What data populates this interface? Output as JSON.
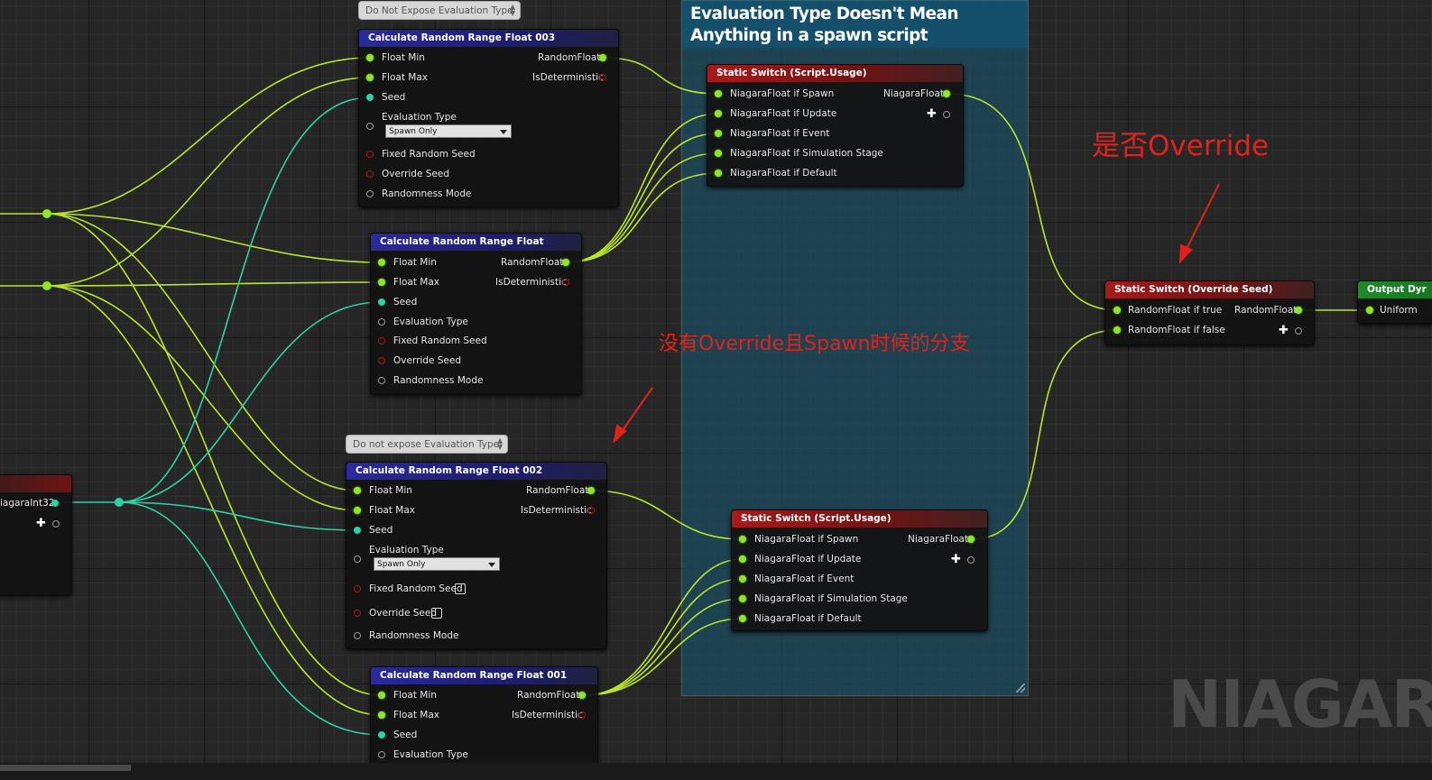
{
  "comment_box": {
    "title": "Evaluation Type Doesn't Mean Anything in a spawn script"
  },
  "bubbles": {
    "top": "Do Not Expose Evaluation Type",
    "mid": "Do not expose Evaluation Type"
  },
  "nodes": {
    "crrf003": {
      "title": "Calculate Random Range Float 003",
      "inputs": [
        "Float Min",
        "Float Max",
        "Seed"
      ],
      "eval_label": "Evaluation Type",
      "eval_value": "Spawn Only",
      "extra": [
        "Fixed Random Seed",
        "Override Seed",
        "Randomness Mode"
      ],
      "outputs": [
        "RandomFloat",
        "IsDeterministic"
      ]
    },
    "crrf": {
      "title": "Calculate Random Range Float",
      "inputs": [
        "Float Min",
        "Float Max",
        "Seed",
        "Evaluation Type",
        "Fixed Random Seed",
        "Override Seed",
        "Randomness Mode"
      ],
      "outputs": [
        "RandomFloat",
        "IsDeterministic"
      ]
    },
    "crrf002": {
      "title": "Calculate Random Range Float 002",
      "inputs": [
        "Float Min",
        "Float Max",
        "Seed"
      ],
      "eval_label": "Evaluation Type",
      "eval_value": "Spawn Only",
      "extra": [
        "Fixed Random Seed",
        "Override Seed",
        "Randomness Mode"
      ],
      "outputs": [
        "RandomFloat",
        "IsDeterministic"
      ]
    },
    "crrf001": {
      "title": "Calculate Random Range Float 001",
      "inputs": [
        "Float Min",
        "Float Max",
        "Seed",
        "Evaluation Type"
      ],
      "outputs": [
        "RandomFloat",
        "IsDeterministic"
      ]
    },
    "switch_top": {
      "title": "Static Switch (Script.Usage)",
      "inputs": [
        "NiagaraFloat if Spawn",
        "NiagaraFloat if Update",
        "NiagaraFloat if Event",
        "NiagaraFloat if Simulation Stage",
        "NiagaraFloat if Default"
      ],
      "output": "NiagaraFloat"
    },
    "switch_bot": {
      "title": "Static Switch (Script.Usage)",
      "inputs": [
        "NiagaraFloat if Spawn",
        "NiagaraFloat if Update",
        "NiagaraFloat if Event",
        "NiagaraFloat if Simulation Stage",
        "NiagaraFloat if Default"
      ],
      "output": "NiagaraFloat"
    },
    "switch_seed": {
      "title": "Static Switch (Override Seed)",
      "inputs": [
        "RandomFloat if true",
        "RandomFloat if false"
      ],
      "output": "RandomFloat"
    },
    "output_dyn": {
      "title": "Output Dyr",
      "input": "Uniform"
    },
    "left_node": {
      "output": "iagaraInt32"
    }
  },
  "annotations": {
    "override": "是否Override",
    "branch": "没有Override且Spawn时候的分支"
  },
  "watermark": "NIAGARA",
  "colors": {
    "float_pin": "#8ee62b",
    "int_pin": "#2ad2a6",
    "bool_pin": "#b01818",
    "annotation": "#e32119",
    "comment_bg": "#1c4e62"
  }
}
